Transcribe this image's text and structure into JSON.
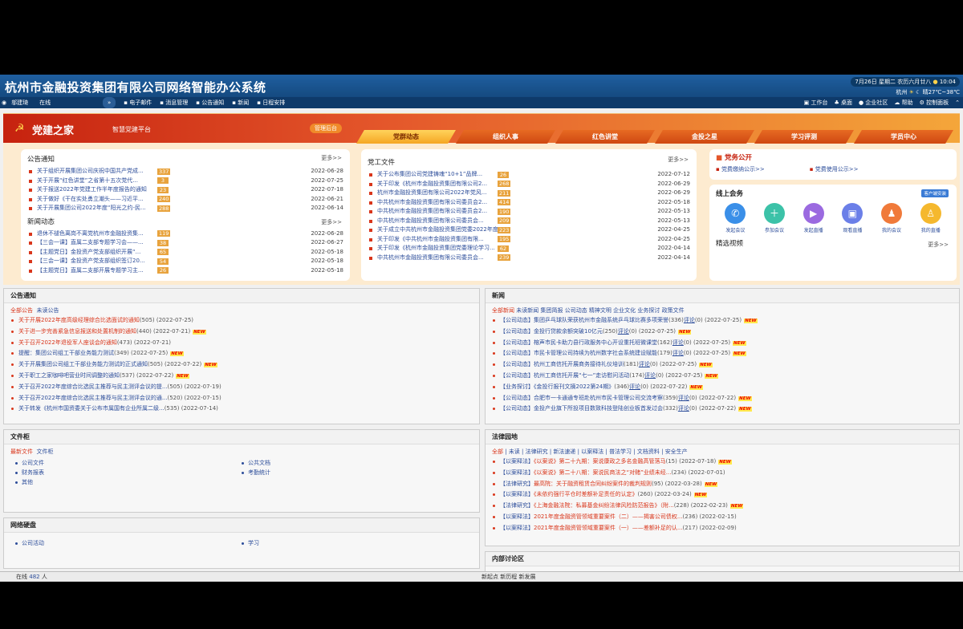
{
  "header": {
    "title": "杭州市金融投资集团有限公司网络智能办公系统",
    "date": "7月26日 星期二 农历六月廿八",
    "time": "10:04",
    "city": "杭州",
    "weather": "晴27℃~38℃"
  },
  "nav": {
    "user": "邬建琦",
    "status": "在线",
    "items": [
      "电子邮件",
      "消息管理",
      "公告通知",
      "新闻",
      "日程安排"
    ],
    "right": [
      "工作台",
      "桌面",
      "企业社区",
      "帮助",
      "控制面板"
    ]
  },
  "party": {
    "logo": "党建之家",
    "sub": "智慧党建平台",
    "admin": "管理后台",
    "tabs": [
      "党群动态",
      "组织人事",
      "红色讲堂",
      "金投之星",
      "学习评测",
      "学员中心"
    ],
    "notice": {
      "title": "公告通知",
      "more": "更多>>",
      "items": [
        {
          "t": "关于组织开展集团公司庆祝中国共产党成...",
          "c": "337",
          "d": "2022-06-28"
        },
        {
          "t": "关于开展“红色讲堂”之省第十五次党代...",
          "c": "3",
          "d": "2022-07-25"
        },
        {
          "t": "关于报送2022年党建工作半年度报告的通知",
          "c": "23",
          "d": "2022-07-18"
        },
        {
          "t": "关于做好《干在实处勇立潮头——习近平...",
          "c": "240",
          "d": "2022-06-21"
        },
        {
          "t": "关于开展集团公司2022年度“阳光之约-民...",
          "c": "288",
          "d": "2022-06-14"
        }
      ]
    },
    "news": {
      "title": "新闻动态",
      "more": "更多>>",
      "items": [
        {
          "t": "退休不褪色离岗不离党杭州市金融投资集...",
          "c": "119",
          "d": "2022-06-28"
        },
        {
          "t": "【三会一课】直属二支部专题学习会——...",
          "c": "38",
          "d": "2022-06-27"
        },
        {
          "t": "【主题党日】金投资产党支部组织开展“...",
          "c": "65",
          "d": "2022-05-18"
        },
        {
          "t": "【三会一课】金投资产党支部组织签订20...",
          "c": "54",
          "d": "2022-05-18"
        },
        {
          "t": "【主题党日】直属二支部开展专题学习主...",
          "c": "26",
          "d": "2022-05-18"
        }
      ]
    },
    "docs": {
      "title": "党工文件",
      "more": "更多>>",
      "items": [
        {
          "t": "关于公布集团公司党建铸魂“10+1”品牌...",
          "c": "26",
          "d": "2022-07-12"
        },
        {
          "t": "关于印发《杭州市金融投资集团有限公司2...",
          "c": "268",
          "d": "2022-06-29"
        },
        {
          "t": "杭州市金融投资集团有限公司2022年党风...",
          "c": "211",
          "d": "2022-06-29"
        },
        {
          "t": "中共杭州市金融投资集团有限公司委员会2...",
          "c": "414",
          "d": "2022-05-18"
        },
        {
          "t": "中共杭州市金融投资集团有限公司委员会2...",
          "c": "190",
          "d": "2022-05-13"
        },
        {
          "t": "中共杭州市金融投资集团有限公司委员会...",
          "c": "209",
          "d": "2022-05-13"
        },
        {
          "t": "关于成立中共杭州市金融投资集团党委2022年度...",
          "c": "223",
          "d": "2022-04-25"
        },
        {
          "t": "关于印发《中共杭州市金融投资集团有限...",
          "c": "195",
          "d": "2022-04-25"
        },
        {
          "t": "关于印发《杭州市金融投资集团党委理论学习...",
          "c": "62",
          "d": "2022-04-14"
        },
        {
          "t": "中共杭州市金融投资集团有限公司委员会...",
          "c": "239",
          "d": "2022-04-14"
        }
      ]
    },
    "affairs": {
      "title": "党务公开",
      "items": [
        "党费缴纳公示>>",
        "党费使用公示>>"
      ]
    },
    "online": {
      "title": "线上会务",
      "badge": "客户端安装",
      "items": [
        "发起会议",
        "参加会议",
        "发起直播",
        "观看直播",
        "我的会议",
        "我的直播"
      ]
    },
    "video": {
      "title": "精选视频",
      "more": "更多>>"
    }
  },
  "announce": {
    "title": "公告通知",
    "filters": [
      "全部公告",
      "未读公告"
    ],
    "items": [
      {
        "t": "关于开展2022年度高级经理综合比选面试的通知",
        "s": "(505) (2022-07-25)",
        "red": true,
        "nw": false
      },
      {
        "t": "关于进一步完善紧急信息报送和处置机制的通知",
        "s": "(440) (2022-07-21)",
        "red": true,
        "nw": true
      },
      {
        "t": "关于召开2022年退役军人座谈会的通知",
        "s": "(473) (2022-07-21)",
        "red": true,
        "nw": false
      },
      {
        "t": "提醒：集团公司组工干部业务能力测试",
        "s": "(349) (2022-07-25)",
        "red": false,
        "nw": true
      },
      {
        "t": "关于开展集团公司组工干部业务能力测试的正式通知",
        "s": "(505) (2022-07-22)",
        "red": false,
        "nw": true
      },
      {
        "t": "关于职工之家咖啡吧营业时间调整的通知",
        "s": "(537) (2022-07-22)",
        "red": false,
        "nw": true
      },
      {
        "t": "关于召开2022年度综合比选民主推荐与民主测评会议的提...",
        "s": "(505) (2022-07-19)",
        "red": false,
        "nw": false
      },
      {
        "t": "关于召开2022年度综合比选民主推荐与民主测评会议的通...",
        "s": "(520) (2022-07-15)",
        "red": false,
        "nw": false
      },
      {
        "t": "关于转发《杭州市国资委关于公布市属国有企业所属二级...",
        "s": "(535) (2022-07-14)",
        "red": false,
        "nw": false
      }
    ]
  },
  "news": {
    "title": "新闻",
    "filters": [
      "全部新闻",
      "未读新闻",
      "集团简报",
      "公司动态",
      "精神文明",
      "企业文化",
      "业务探讨",
      "政策文件"
    ],
    "items": [
      {
        "t": "【公司动态】集团乒乓球队荣获杭州市金融系统乒乓球比赛多项荣誉",
        "n": "(336)",
        "cm": "评论",
        "s": "(0) (2022-07-25)"
      },
      {
        "t": "【公司动态】金投行贷款余额突破10亿元",
        "n": "(250)",
        "cm": "评论",
        "s": "(0) (2022-07-25)"
      },
      {
        "t": "【公司动态】榕声市民卡助力县行政服务中心开设重托班微课堂",
        "n": "(162)",
        "cm": "评论",
        "s": "(0) (2022-07-25)"
      },
      {
        "t": "【公司动态】市民卡管理公司持续为杭州数字社会系统建设赋能",
        "n": "(179)",
        "cm": "评论",
        "s": "(0) (2022-07-25)"
      },
      {
        "t": "【公司动态】杭州工商信托开展商务接待礼仪培训",
        "n": "(181)",
        "cm": "评论",
        "s": "(0) (2022-07-25)"
      },
      {
        "t": "【公司动态】杭州工商信托开展“七一”走访慰问活动",
        "n": "(174)",
        "cm": "评论",
        "s": "(0) (2022-07-25)"
      },
      {
        "t": "【业务探讨】《金投行报刊文摘2022第24期》",
        "n": "(346)",
        "cm": "评论",
        "s": "(0) (2022-07-22)"
      },
      {
        "t": "【公司动态】合肥市一卡通通专班赴杭州市民卡管理公司交流考察",
        "n": "(359)",
        "cm": "评论",
        "s": "(0) (2022-07-22)"
      },
      {
        "t": "【公司动态】金投产业旗下所投项目数致科技登陆创业板首发过会",
        "n": "(332)",
        "cm": "评论",
        "s": "(0) (2022-07-22)"
      }
    ]
  },
  "files": {
    "title": "文件柜",
    "filters": [
      "最新文件",
      "文件柜"
    ],
    "items": [
      "公司文件",
      "公共文档",
      "财务报表",
      "考勤统计",
      "其他"
    ]
  },
  "law": {
    "title": "法律园地",
    "filters": [
      "全部",
      "未读",
      "法律研究",
      "新法速递",
      "以案释法",
      "普法学习",
      "文档资料",
      "安全生产"
    ],
    "items": [
      {
        "t": "【以案释法】《以案说》第二十九期：案说康政之多名金融高管落马",
        "s": "(15) (2022-07-18)",
        "nw": true
      },
      {
        "t": "【以案释法】《以案说》第二十八期：案说民商法之“对赌”业绩未经...",
        "s": "(234) (2022-07-01)",
        "nw": false
      },
      {
        "t": "【法律研究】最高院：关于融资租赁合同纠纷案件的裁判规则",
        "s": "(95) (2022-03-28)",
        "nw": true
      },
      {
        "t": "【以案释法】《未依约强行平仓时差额补足责任的认定》",
        "s": "(260) (2022-03-24)",
        "nw": true
      },
      {
        "t": "【法律研究】《上海金融法院：私募基金纠纷法律风险防范报告》（附...",
        "s": "(228) (2022-02-23)",
        "nw": true
      },
      {
        "t": "【以案释法】2021年度金融资管领域重要案件（二）——揭害公司债权...",
        "s": "(236) (2022-02-15)",
        "nw": false
      },
      {
        "t": "【以案释法】2021年度金融资管领域重要案件（一）——差额补足的认...",
        "s": "(217) (2022-02-09)",
        "nw": false
      }
    ]
  },
  "disk": {
    "title": "网络硬盘",
    "items": [
      "公司活动",
      "学习"
    ]
  },
  "forum": {
    "title": "内部讨论区"
  },
  "footer": {
    "online_label": "在线",
    "online_count": "482",
    "online_unit": "人",
    "center": "新起点 新历程 新发展"
  }
}
